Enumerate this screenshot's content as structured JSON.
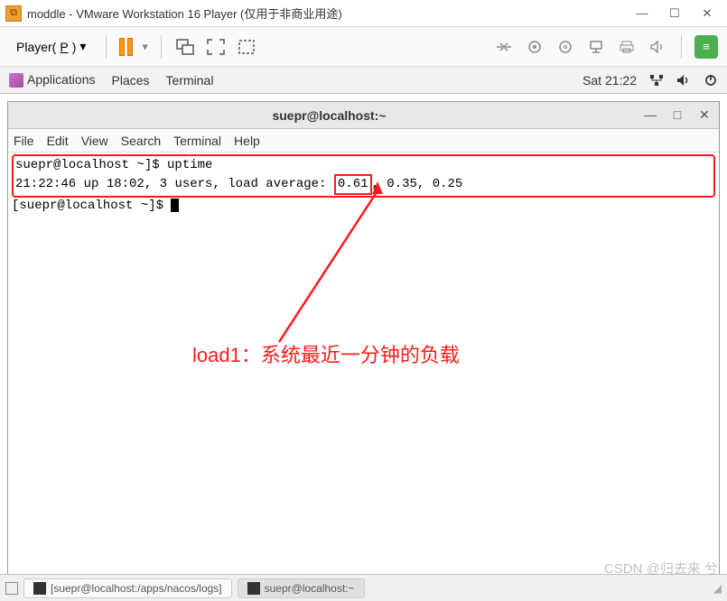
{
  "vmware": {
    "title": "moddle - VMware Workstation 16 Player (仅用于非商业用途)",
    "player_label_prefix": "Player(",
    "player_label_key": "P",
    "player_label_suffix": ")"
  },
  "gnome": {
    "applications": "Applications",
    "places": "Places",
    "terminal": "Terminal",
    "clock": "Sat 21:22"
  },
  "terminal": {
    "title": "suepr@localhost:~",
    "menu": [
      "File",
      "Edit",
      "View",
      "Search",
      "Terminal",
      "Help"
    ],
    "line1_prompt": "suepr@localhost ~]$ ",
    "line1_cmd": "uptime",
    "line2_time": "21:22:46 up 18:02,",
    "line2_users": "  3 users,",
    "line2_loadlabel": "  load average:",
    "line2_load1": "0.61",
    "line2_loadrest": ", 0.35, 0.25",
    "line3_prompt": "[suepr@localhost ~]$ "
  },
  "annotation": {
    "text": "load1：系统最近一分钟的负载"
  },
  "taskbar": {
    "item1": "[suepr@localhost:/apps/nacos/logs]",
    "item2": "suepr@localhost:~"
  },
  "watermark": "CSDN @归去来 兮"
}
